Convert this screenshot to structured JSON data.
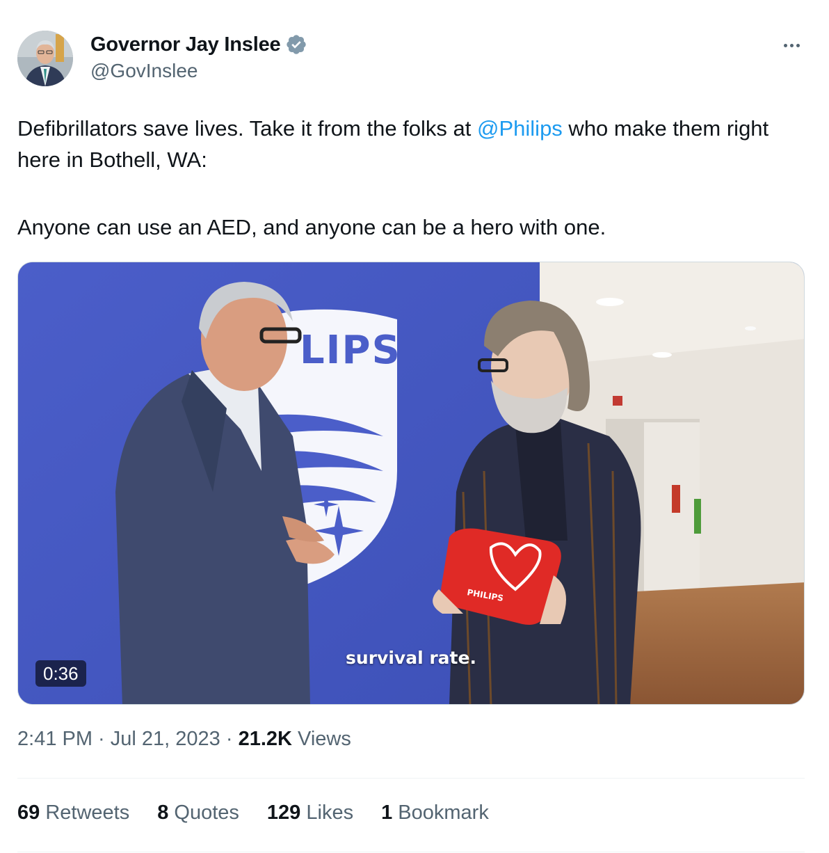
{
  "author": {
    "name": "Governor Jay Inslee",
    "handle": "@GovInslee",
    "verified_icon": "verified-badge-icon",
    "verified_color": "#829aab"
  },
  "tweet": {
    "line1_before": "Defibrillators save lives. Take it from the folks at ",
    "mention": "@Philips",
    "line1_after": " who make them right here in Bothell, WA:",
    "line2": "Anyone can use an AED, and anyone can be a hero with one."
  },
  "media": {
    "duration": "0:36",
    "caption": "survival rate.",
    "wall_logo_text": "LIPS",
    "aed_brand": "PHILIPS"
  },
  "meta": {
    "time": "2:41 PM",
    "separator": " · ",
    "date": "Jul 21, 2023",
    "views_count": "21.2K",
    "views_label": "Views"
  },
  "stats": {
    "retweets_count": "69",
    "retweets_label": "Retweets",
    "quotes_count": "8",
    "quotes_label": "Quotes",
    "likes_count": "129",
    "likes_label": "Likes",
    "bookmarks_count": "1",
    "bookmarks_label": "Bookmark"
  },
  "colors": {
    "link": "#1d9bf0",
    "secondary_text": "#536471",
    "primary_text": "#0f1419",
    "wall_blue": "#4a5fc7"
  }
}
